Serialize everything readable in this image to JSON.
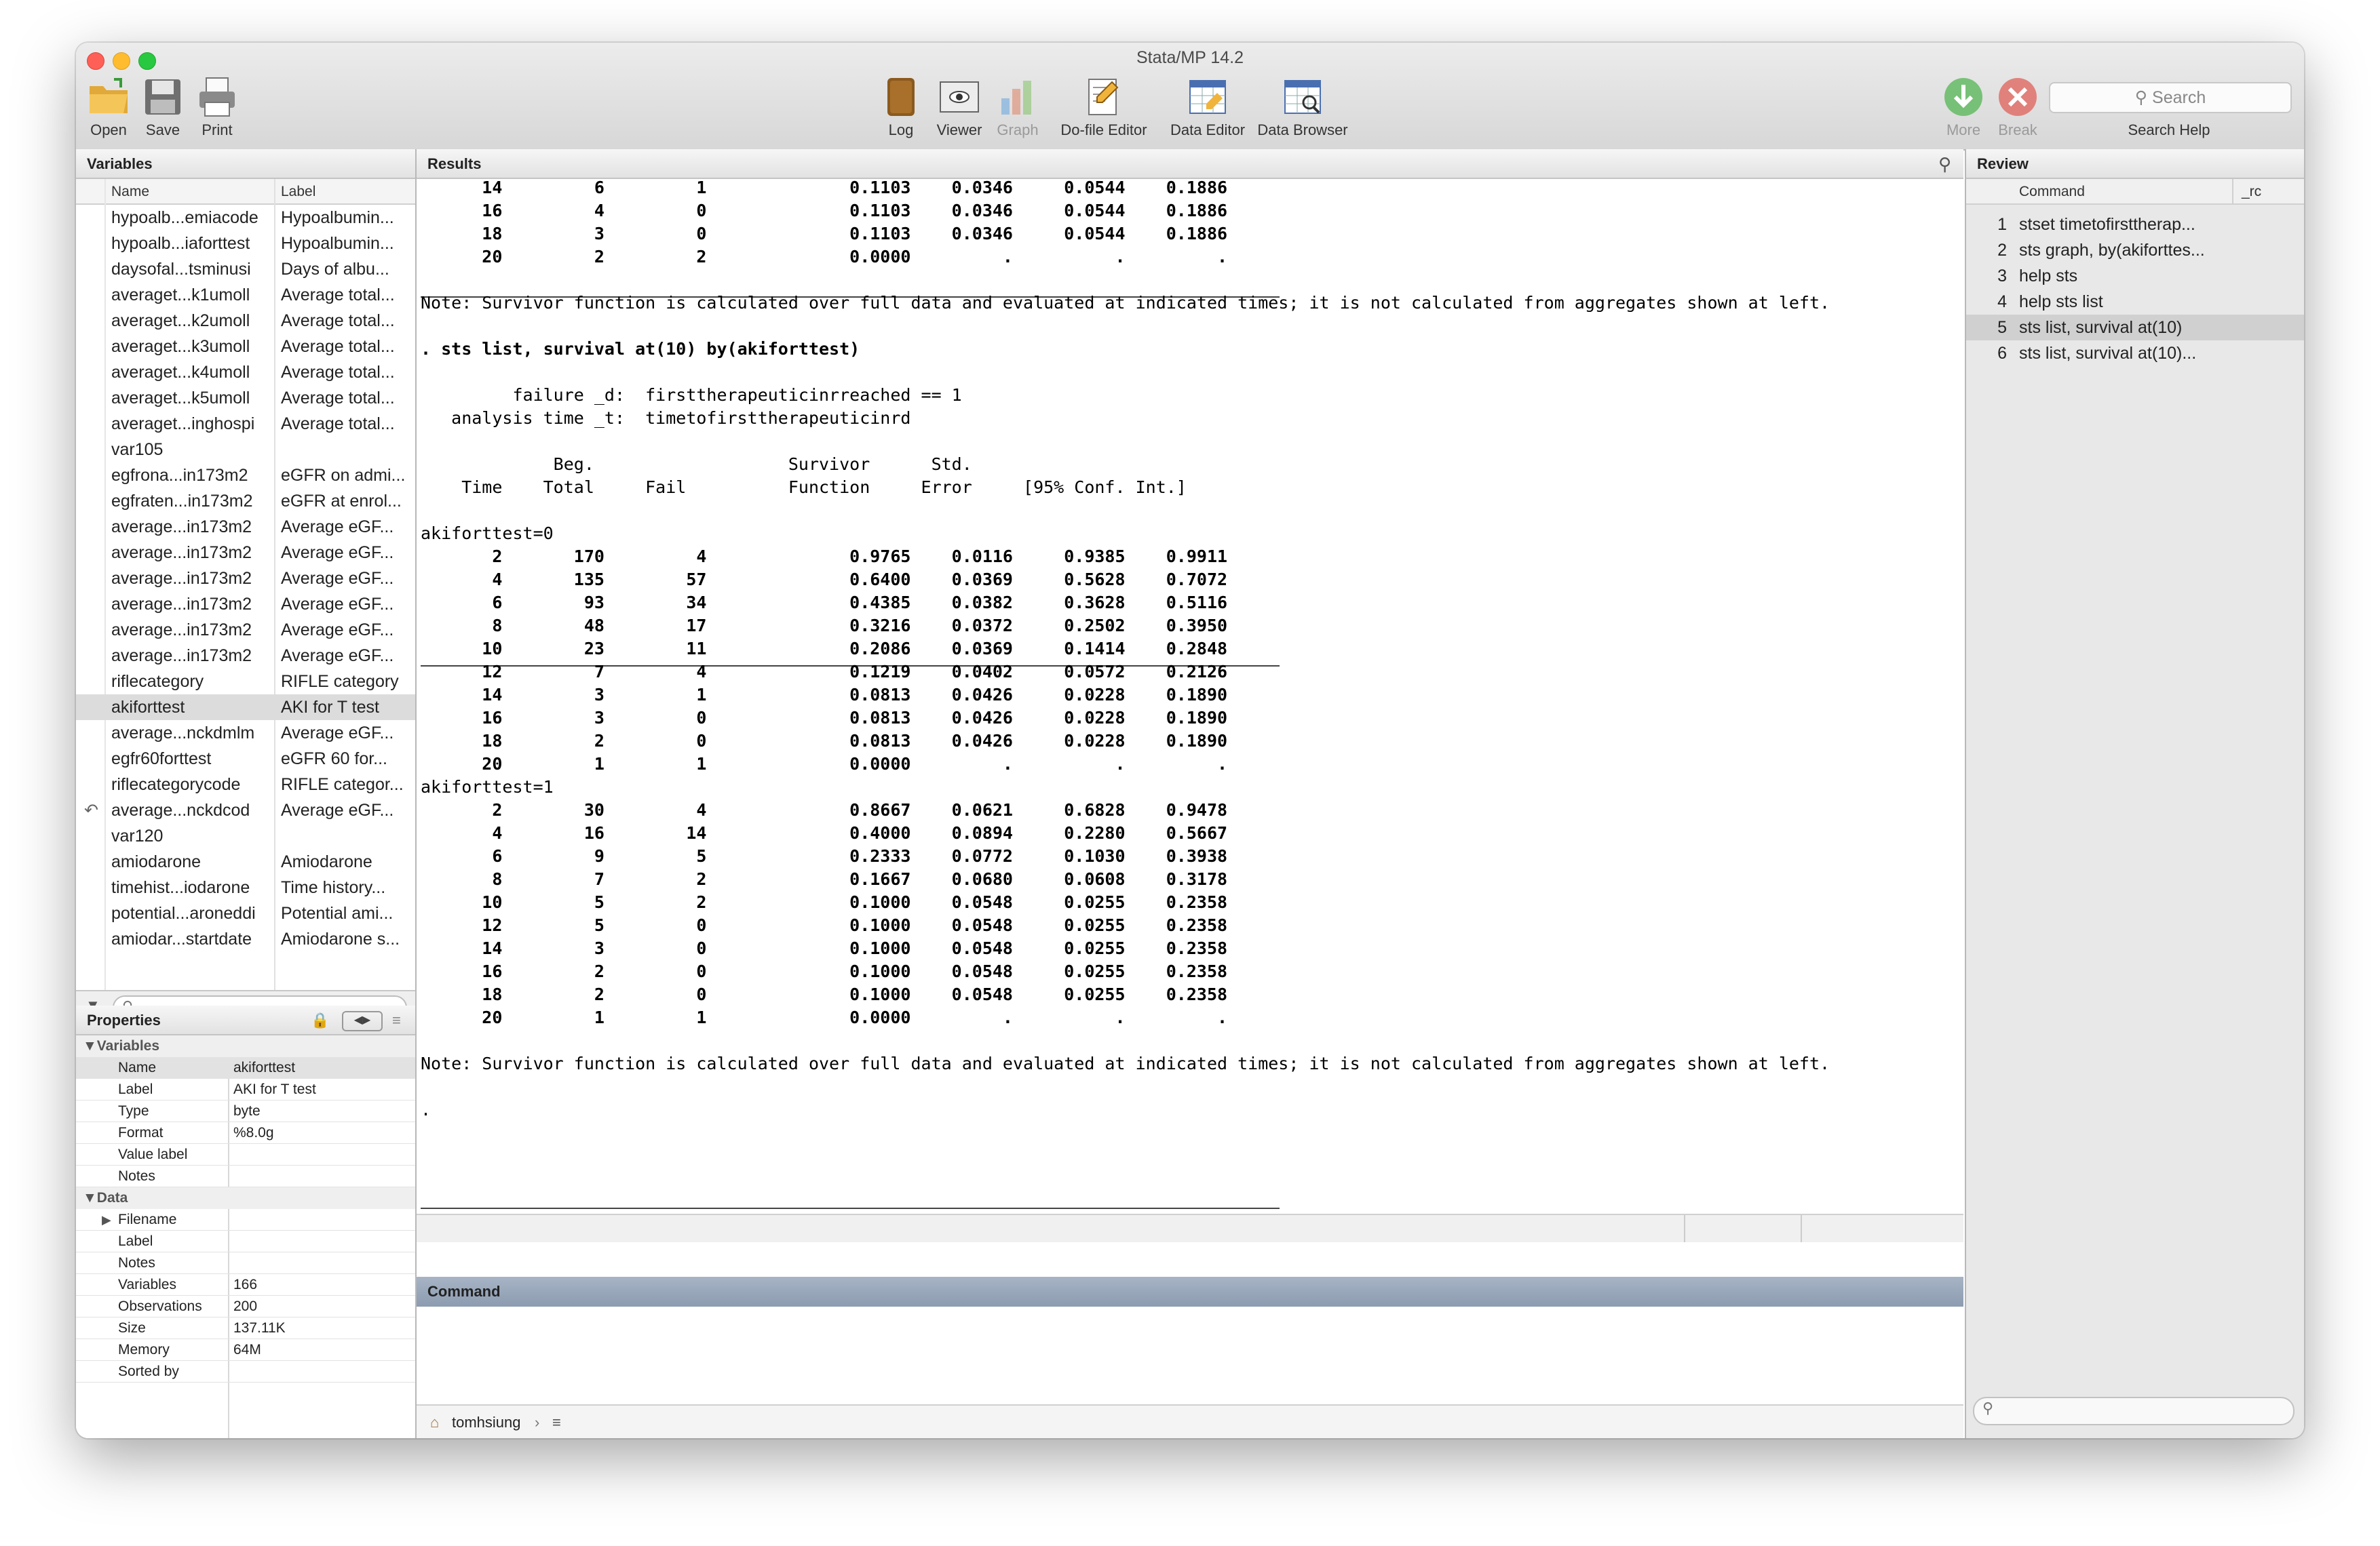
{
  "window": {
    "title": "Stata/MP 14.2"
  },
  "toolbar": {
    "open": "Open",
    "save": "Save",
    "print": "Print",
    "log": "Log",
    "viewer": "Viewer",
    "graph": "Graph",
    "dofile": "Do-file Editor",
    "dataeditor": "Data Editor",
    "databrowser": "Data Browser",
    "more": "More",
    "break": "Break",
    "search_placeholder": "Search",
    "search_help": "Search Help"
  },
  "variables": {
    "title": "Variables",
    "col_name": "Name",
    "col_label": "Label",
    "rows": [
      {
        "name": "hypoalb...emiacode",
        "label": "Hypoalbumin..."
      },
      {
        "name": "hypoalb...iaforttest",
        "label": "Hypoalbumin..."
      },
      {
        "name": "daysofal...tsminusi",
        "label": "Days of albu..."
      },
      {
        "name": "averaget...k1umoll",
        "label": "Average total..."
      },
      {
        "name": "averaget...k2umoll",
        "label": "Average total..."
      },
      {
        "name": "averaget...k3umoll",
        "label": "Average total..."
      },
      {
        "name": "averaget...k4umoll",
        "label": "Average total..."
      },
      {
        "name": "averaget...k5umoll",
        "label": "Average total..."
      },
      {
        "name": "averaget...inghospi",
        "label": "Average total..."
      },
      {
        "name": "var105",
        "label": ""
      },
      {
        "name": "egfrona...in173m2",
        "label": "eGFR on admi..."
      },
      {
        "name": "egfraten...in173m2",
        "label": "eGFR at enrol..."
      },
      {
        "name": "average...in173m2",
        "label": "Average eGF..."
      },
      {
        "name": "average...in173m2",
        "label": "Average eGF..."
      },
      {
        "name": "average...in173m2",
        "label": "Average eGF..."
      },
      {
        "name": "average...in173m2",
        "label": "Average eGF..."
      },
      {
        "name": "average...in173m2",
        "label": "Average eGF..."
      },
      {
        "name": "average...in173m2",
        "label": "Average eGF..."
      },
      {
        "name": "riflecategory",
        "label": "RIFLE category"
      },
      {
        "name": "akiforttest",
        "label": "AKI for T test"
      },
      {
        "name": "average...nckdmlm",
        "label": "Average eGF..."
      },
      {
        "name": "egfr60forttest",
        "label": "eGFR 60 for..."
      },
      {
        "name": "riflecategorycode",
        "label": "RIFLE categor..."
      },
      {
        "name": "average...nckdcod",
        "label": "Average eGF..."
      },
      {
        "name": "var120",
        "label": ""
      },
      {
        "name": "amiodarone",
        "label": "Amiodarone"
      },
      {
        "name": "timehist...iodarone",
        "label": "Time history..."
      },
      {
        "name": "potential...aroneddi",
        "label": "Potential ami..."
      },
      {
        "name": "amiodar...startdate",
        "label": "Amiodarone s..."
      }
    ]
  },
  "properties": {
    "title": "Properties",
    "group_variables": "Variables",
    "group_data": "Data",
    "variable_rows": [
      {
        "k": "Name",
        "v": "akiforttest"
      },
      {
        "k": "Label",
        "v": "AKI for T test"
      },
      {
        "k": "Type",
        "v": "byte"
      },
      {
        "k": "Format",
        "v": "%8.0g"
      },
      {
        "k": "Value label",
        "v": ""
      },
      {
        "k": "Notes",
        "v": ""
      }
    ],
    "data_rows": [
      {
        "k": "Filename",
        "v": ""
      },
      {
        "k": "Label",
        "v": ""
      },
      {
        "k": "Notes",
        "v": ""
      },
      {
        "k": "Variables",
        "v": "166"
      },
      {
        "k": "Observations",
        "v": "200"
      },
      {
        "k": "Size",
        "v": "137.11K"
      },
      {
        "k": "Memory",
        "v": "64M"
      },
      {
        "k": "Sorted by",
        "v": ""
      }
    ]
  },
  "results": {
    "title": "Results",
    "lines": [
      {
        "t": "      14         6         1              0.1103    0.0346     0.0544    0.1886",
        "b": true
      },
      {
        "t": "      16         4         0              0.1103    0.0346     0.0544    0.1886",
        "b": true
      },
      {
        "t": "      18         3         0              0.1103    0.0346     0.0544    0.1886",
        "b": true
      },
      {
        "t": "      20         2         2              0.0000         .          .         .",
        "b": true
      },
      {
        "t": "",
        "b": false
      },
      {
        "t": "Note: Survivor function is calculated over full data and evaluated at indicated times; it is not calculated from aggregates shown at left.",
        "b": false
      },
      {
        "t": "",
        "b": false
      },
      {
        "t": ". sts list, survival at(10) by(akiforttest)",
        "b": true
      },
      {
        "t": "",
        "b": false
      },
      {
        "t": "         failure _d:  firsttherapeuticinrreached == 1",
        "b": false
      },
      {
        "t": "   analysis time _t:  timetofirsttherapeuticinrd",
        "b": false
      },
      {
        "t": "",
        "b": false
      },
      {
        "t": "             Beg.                   Survivor      Std.",
        "b": false
      },
      {
        "t": "    Time    Total     Fail          Function     Error     [95% Conf. Int.]",
        "b": false
      },
      {
        "t": "",
        "b": false
      },
      {
        "t": "akiforttest=0",
        "b": false
      },
      {
        "t": "       2       170         4              0.9765    0.0116     0.9385    0.9911",
        "b": true
      },
      {
        "t": "       4       135        57              0.6400    0.0369     0.5628    0.7072",
        "b": true
      },
      {
        "t": "       6        93        34              0.4385    0.0382     0.3628    0.5116",
        "b": true
      },
      {
        "t": "       8        48        17              0.3216    0.0372     0.2502    0.3950",
        "b": true
      },
      {
        "t": "      10        23        11              0.2086    0.0369     0.1414    0.2848",
        "b": true
      },
      {
        "t": "      12         7         4              0.1219    0.0402     0.0572    0.2126",
        "b": true
      },
      {
        "t": "      14         3         1              0.0813    0.0426     0.0228    0.1890",
        "b": true
      },
      {
        "t": "      16         3         0              0.0813    0.0426     0.0228    0.1890",
        "b": true
      },
      {
        "t": "      18         2         0              0.0813    0.0426     0.0228    0.1890",
        "b": true
      },
      {
        "t": "      20         1         1              0.0000         .          .         .",
        "b": true
      },
      {
        "t": "akiforttest=1",
        "b": false
      },
      {
        "t": "       2        30         4              0.8667    0.0621     0.6828    0.9478",
        "b": true
      },
      {
        "t": "       4        16        14              0.4000    0.0894     0.2280    0.5667",
        "b": true
      },
      {
        "t": "       6         9         5              0.2333    0.0772     0.1030    0.3938",
        "b": true
      },
      {
        "t": "       8         7         2              0.1667    0.0680     0.0608    0.3178",
        "b": true
      },
      {
        "t": "      10         5         2              0.1000    0.0548     0.0255    0.2358",
        "b": true
      },
      {
        "t": "      12         5         0              0.1000    0.0548     0.0255    0.2358",
        "b": true
      },
      {
        "t": "      14         3         0              0.1000    0.0548     0.0255    0.2358",
        "b": true
      },
      {
        "t": "      16         2         0              0.1000    0.0548     0.0255    0.2358",
        "b": true
      },
      {
        "t": "      18         2         0              0.1000    0.0548     0.0255    0.2358",
        "b": true
      },
      {
        "t": "      20         1         1              0.0000         .          .         .",
        "b": true
      },
      {
        "t": "",
        "b": false
      },
      {
        "t": "Note: Survivor function is calculated over full data and evaluated at indicated times; it is not calculated from aggregates shown at left.",
        "b": false
      },
      {
        "t": "",
        "b": false
      },
      {
        "t": ".",
        "b": false
      }
    ]
  },
  "command": {
    "title": "Command"
  },
  "statusbar": {
    "path": "tomhsiung"
  },
  "review": {
    "title": "Review",
    "col_command": "Command",
    "col_rc": "_rc",
    "rows": [
      {
        "n": "1",
        "cmd": "stset timetofirsttherap..."
      },
      {
        "n": "2",
        "cmd": "sts graph, by(akiforttes..."
      },
      {
        "n": "3",
        "cmd": "help sts"
      },
      {
        "n": "4",
        "cmd": "help sts list"
      },
      {
        "n": "5",
        "cmd": "sts list, survival at(10)"
      },
      {
        "n": "6",
        "cmd": "sts list, survival at(10)..."
      }
    ]
  }
}
